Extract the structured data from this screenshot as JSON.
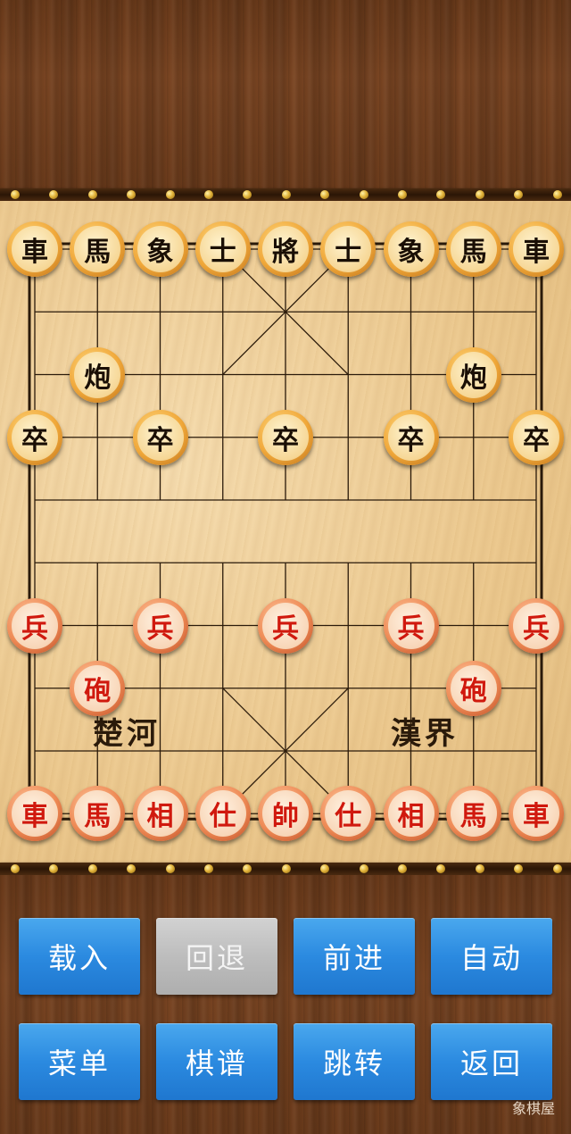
{
  "board": {
    "river_left": "楚河",
    "river_right": "漢界",
    "colors": {
      "black_text": "#1a0f05",
      "red_text": "#d0190e",
      "line": "#2a1a0a"
    }
  },
  "pieces": [
    {
      "label": "車",
      "side": "black",
      "col": 0,
      "row": 0
    },
    {
      "label": "馬",
      "side": "black",
      "col": 1,
      "row": 0
    },
    {
      "label": "象",
      "side": "black",
      "col": 2,
      "row": 0
    },
    {
      "label": "士",
      "side": "black",
      "col": 3,
      "row": 0
    },
    {
      "label": "將",
      "side": "black",
      "col": 4,
      "row": 0
    },
    {
      "label": "士",
      "side": "black",
      "col": 5,
      "row": 0
    },
    {
      "label": "象",
      "side": "black",
      "col": 6,
      "row": 0
    },
    {
      "label": "馬",
      "side": "black",
      "col": 7,
      "row": 0
    },
    {
      "label": "車",
      "side": "black",
      "col": 8,
      "row": 0
    },
    {
      "label": "炮",
      "side": "black",
      "col": 1,
      "row": 2
    },
    {
      "label": "炮",
      "side": "black",
      "col": 7,
      "row": 2
    },
    {
      "label": "卒",
      "side": "black",
      "col": 0,
      "row": 3
    },
    {
      "label": "卒",
      "side": "black",
      "col": 2,
      "row": 3
    },
    {
      "label": "卒",
      "side": "black",
      "col": 4,
      "row": 3
    },
    {
      "label": "卒",
      "side": "black",
      "col": 6,
      "row": 3
    },
    {
      "label": "卒",
      "side": "black",
      "col": 8,
      "row": 3
    },
    {
      "label": "兵",
      "side": "red",
      "col": 0,
      "row": 6
    },
    {
      "label": "兵",
      "side": "red",
      "col": 2,
      "row": 6
    },
    {
      "label": "兵",
      "side": "red",
      "col": 4,
      "row": 6
    },
    {
      "label": "兵",
      "side": "red",
      "col": 6,
      "row": 6
    },
    {
      "label": "兵",
      "side": "red",
      "col": 8,
      "row": 6
    },
    {
      "label": "砲",
      "side": "red",
      "col": 1,
      "row": 7
    },
    {
      "label": "砲",
      "side": "red",
      "col": 7,
      "row": 7
    },
    {
      "label": "車",
      "side": "red",
      "col": 0,
      "row": 9
    },
    {
      "label": "馬",
      "side": "red",
      "col": 1,
      "row": 9
    },
    {
      "label": "相",
      "side": "red",
      "col": 2,
      "row": 9
    },
    {
      "label": "仕",
      "side": "red",
      "col": 3,
      "row": 9
    },
    {
      "label": "帥",
      "side": "red",
      "col": 4,
      "row": 9
    },
    {
      "label": "仕",
      "side": "red",
      "col": 5,
      "row": 9
    },
    {
      "label": "相",
      "side": "red",
      "col": 6,
      "row": 9
    },
    {
      "label": "馬",
      "side": "red",
      "col": 7,
      "row": 9
    },
    {
      "label": "車",
      "side": "red",
      "col": 8,
      "row": 9
    }
  ],
  "buttons": [
    {
      "id": "load",
      "label": "载入",
      "enabled": true
    },
    {
      "id": "undo",
      "label": "回退",
      "enabled": false
    },
    {
      "id": "forward",
      "label": "前进",
      "enabled": true
    },
    {
      "id": "auto",
      "label": "自动",
      "enabled": true
    },
    {
      "id": "menu",
      "label": "菜单",
      "enabled": true
    },
    {
      "id": "records",
      "label": "棋谱",
      "enabled": true
    },
    {
      "id": "jump",
      "label": "跳转",
      "enabled": true
    },
    {
      "id": "back",
      "label": "返回",
      "enabled": true
    }
  ],
  "watermark": "象棋屋"
}
